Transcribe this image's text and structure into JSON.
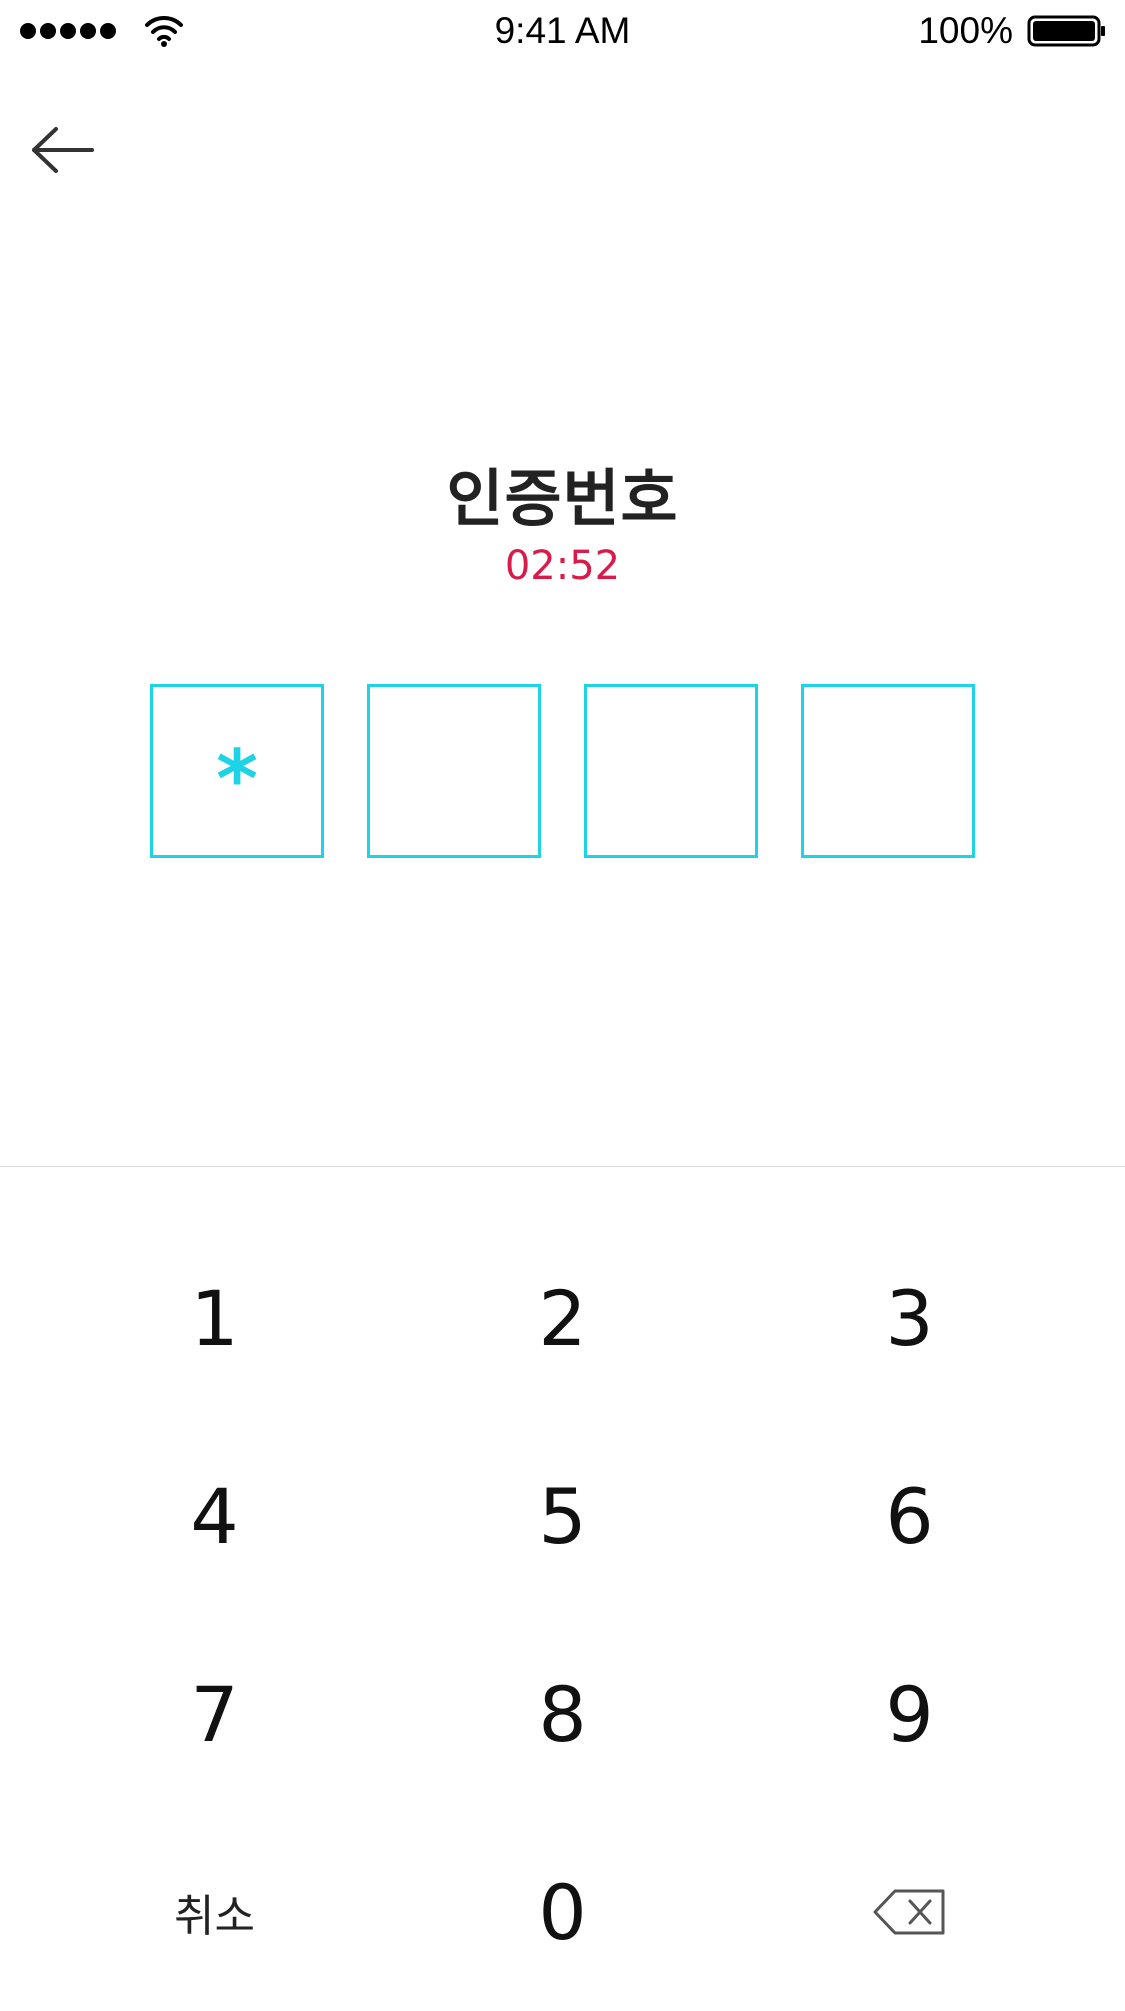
{
  "status_bar": {
    "time": "9:41 AM",
    "battery_percent": "100%",
    "signal_bars": 5,
    "icons": [
      "signal-dots-icon",
      "wifi-icon",
      "battery-icon"
    ]
  },
  "nav": {
    "back_icon": "arrow-left-icon"
  },
  "title": "인증번호",
  "timer": "02:52",
  "code": {
    "length": 4,
    "chars": [
      "*",
      "",
      "",
      ""
    ]
  },
  "keypad": {
    "keys": [
      [
        "1",
        "2",
        "3"
      ],
      [
        "4",
        "5",
        "6"
      ],
      [
        "7",
        "8",
        "9"
      ]
    ],
    "cancel_label": "취소",
    "zero": "0",
    "backspace_icon": "backspace-icon"
  },
  "colors": {
    "accent": "#1fd3e6",
    "timer": "#d81b48",
    "divider": "#d6d6d6",
    "text": "#222222"
  }
}
